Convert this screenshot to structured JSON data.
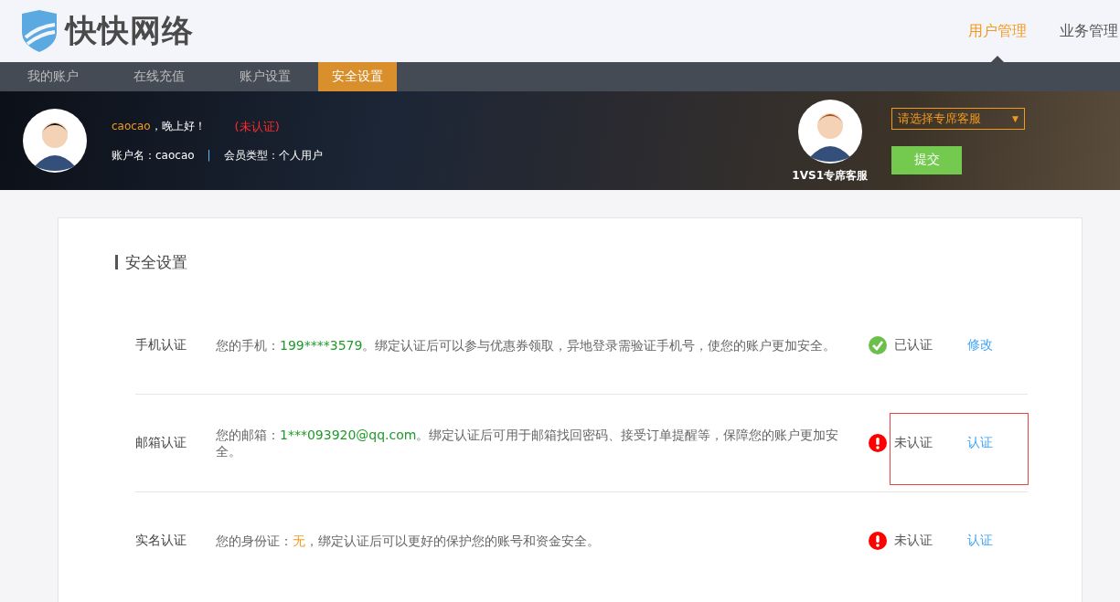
{
  "logo": {
    "text": "快快网络"
  },
  "top_nav": [
    {
      "label": "用户管理",
      "selected": true
    },
    {
      "label": "业务管理",
      "selected": false
    }
  ],
  "tabs": [
    {
      "label": "我的账户",
      "selected": false
    },
    {
      "label": "在线充值",
      "selected": false
    },
    {
      "label": "账户设置",
      "selected": false
    },
    {
      "label": "安全设置",
      "selected": true
    }
  ],
  "user": {
    "name": "caocao",
    "greeting": "，晚上好！",
    "status": "(未认证)",
    "account_label": "账户名：caocao",
    "separator": "|",
    "member_type": "会员类型：个人用户"
  },
  "service": {
    "caption": "1VS1专席客服",
    "select_placeholder": "请选择专席客服",
    "select_arrow": "▼",
    "submit": "提交"
  },
  "section": {
    "title": "安全设置"
  },
  "rows": [
    {
      "label": "手机认证",
      "prefix": "您的手机：",
      "value": "199****3579",
      "value_missing": false,
      "suffix": "。绑定认证后可以参与优惠券领取，异地登录需验证手机号，使您的账户更加安全。",
      "verified": true,
      "status": "已认证",
      "action": "修改",
      "highlighted": false
    },
    {
      "label": "邮箱认证",
      "prefix": "您的邮箱：",
      "value": "1***093920@qq.com",
      "value_missing": false,
      "suffix": "。绑定认证后可用于邮箱找回密码、接受订单提醒等，保障您的账户更加安全。",
      "verified": false,
      "status": "未认证",
      "action": "认证",
      "highlighted": true
    },
    {
      "label": "实名认证",
      "prefix": "您的身份证：",
      "value": "无",
      "value_missing": true,
      "suffix": "，绑定认证后可以更好的保护您的账号和资金安全。",
      "verified": false,
      "status": "未认证",
      "action": "认证",
      "highlighted": false
    }
  ]
}
